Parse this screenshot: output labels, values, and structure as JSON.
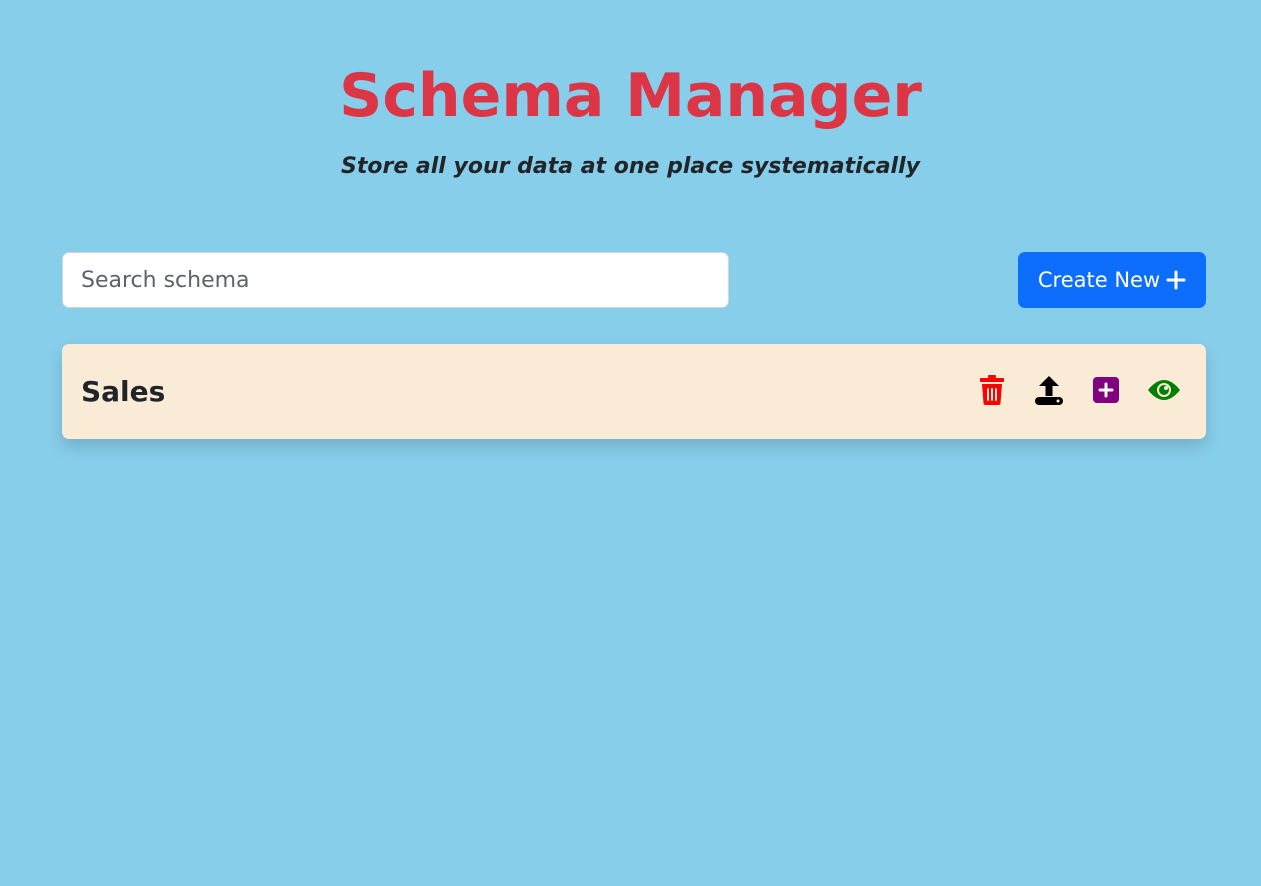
{
  "header": {
    "title": "Schema Manager",
    "subtitle": "Store all your data at one place systematically"
  },
  "search": {
    "placeholder": "Search schema",
    "value": ""
  },
  "create_button": {
    "label": "Create New",
    "icon": "plus-icon"
  },
  "schemas": [
    {
      "name": "Sales",
      "actions": [
        {
          "icon": "trash-icon",
          "color": "#ff0000"
        },
        {
          "icon": "upload-icon",
          "color": "#000000"
        },
        {
          "icon": "plus-square-icon",
          "color": "#800080"
        },
        {
          "icon": "eye-icon",
          "color": "#008000"
        }
      ]
    }
  ],
  "colors": {
    "page_background": "#87ceeb",
    "title": "#dc3545",
    "primary_button": "#0d6efd",
    "card_background": "#faebd7"
  }
}
